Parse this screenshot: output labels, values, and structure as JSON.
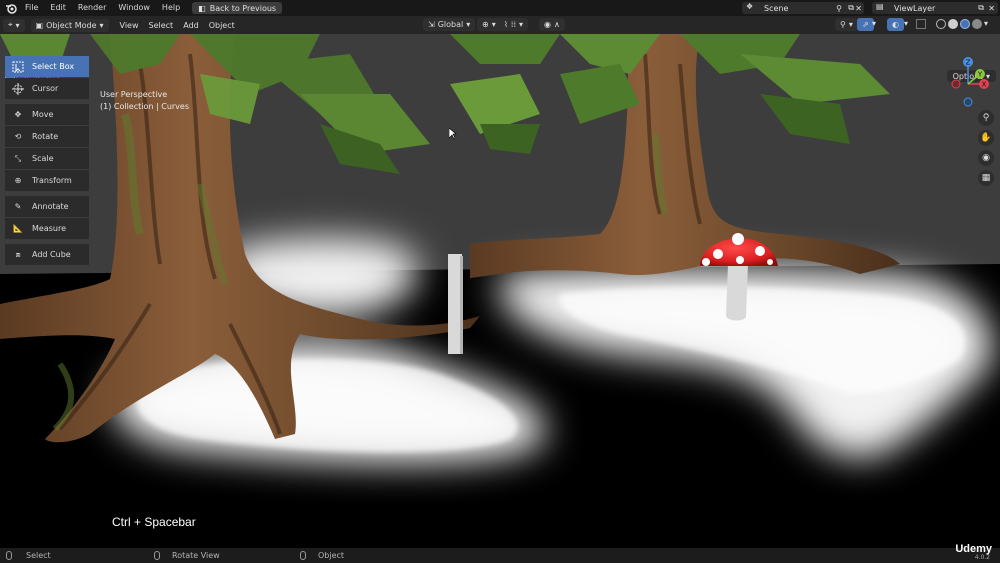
{
  "topbar": {
    "menus": [
      "File",
      "Edit",
      "Render",
      "Window",
      "Help"
    ],
    "back_button": "Back to Previous",
    "scene": "Scene",
    "view_layer": "ViewLayer"
  },
  "header": {
    "mode": "Object Mode",
    "menus": [
      "View",
      "Select",
      "Add",
      "Object"
    ],
    "transform_orientation": "Global"
  },
  "toolbar": {
    "tools": [
      {
        "label": "Select Box",
        "icon": "select-box-icon",
        "active": true
      },
      {
        "label": "Cursor",
        "icon": "cursor-icon",
        "active": false
      },
      {
        "label": "Move",
        "icon": "move-icon",
        "active": false
      },
      {
        "label": "Rotate",
        "icon": "rotate-icon",
        "active": false
      },
      {
        "label": "Scale",
        "icon": "scale-icon",
        "active": false
      },
      {
        "label": "Transform",
        "icon": "transform-icon",
        "active": false
      },
      {
        "label": "Annotate",
        "icon": "annotate-icon",
        "active": false
      },
      {
        "label": "Measure",
        "icon": "measure-icon",
        "active": false
      },
      {
        "label": "Add Cube",
        "icon": "add-cube-icon",
        "active": false
      }
    ]
  },
  "viewport": {
    "perspective": "User Perspective",
    "collection": "(1) Collection | Curves",
    "options_label": "Options",
    "shortcut_overlay": "Ctrl + Spacebar"
  },
  "gizmo": {
    "x": "X",
    "y": "Y",
    "z": "Z"
  },
  "statusbar": {
    "select": "Select",
    "rotate_view": "Rotate View",
    "object": "Object",
    "version": "4.0.2"
  },
  "watermark": "Udemy",
  "colors": {
    "accent": "#4772b3",
    "x_axis": "#e0424f",
    "y_axis": "#8cc63f",
    "z_axis": "#4a8fe3",
    "mushroom_cap": "#d91f1f"
  }
}
